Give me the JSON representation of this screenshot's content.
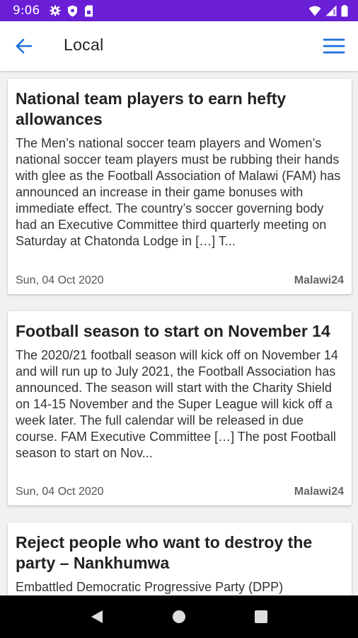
{
  "status_bar": {
    "time": "9:06",
    "icons": [
      "gear-icon",
      "shield-icon",
      "sim-card-icon",
      "wifi-icon",
      "signal-icon",
      "battery-icon"
    ],
    "background_color": "#6a1fd6"
  },
  "app_bar": {
    "title": "Local",
    "back_icon": "arrow-back-icon",
    "menu_icon": "hamburger-menu-icon",
    "accent_color": "#1e6fd9"
  },
  "articles": [
    {
      "title": "National team players to earn hefty allowances",
      "excerpt": "The Men’s national soccer team players and Women’s national soccer team players must be rubbing their hands with glee as the Football Association of Malawi (FAM) has announced an increase in their game bonuses with immediate effect. The country’s soccer governing body had an Executive Committee third quarterly meeting on Saturday at Chatonda Lodge in […] T...",
      "date": "Sun, 04 Oct 2020",
      "source": "Malawi24"
    },
    {
      "title": "Football season to start on November 14",
      "excerpt": "The 2020/21 football season will kick off on November 14 and will run up to July 2021, the Football Association has announced. The season will start with the Charity Shield on 14-15 November and the Super League will kick off a week later. The full calendar will be released in due course. FAM Executive Committee […] The post Football season to start on Nov...",
      "date": "Sun, 04 Oct 2020",
      "source": "Malawi24"
    },
    {
      "title": "Reject people who want to destroy the party – Nankhumwa",
      "excerpt": "Embattled Democratic Progressive Party (DPP)",
      "date": "",
      "source": ""
    }
  ],
  "nav_bar": {
    "icons": [
      "back-triangle-icon",
      "home-circle-icon",
      "recents-square-icon"
    ]
  }
}
